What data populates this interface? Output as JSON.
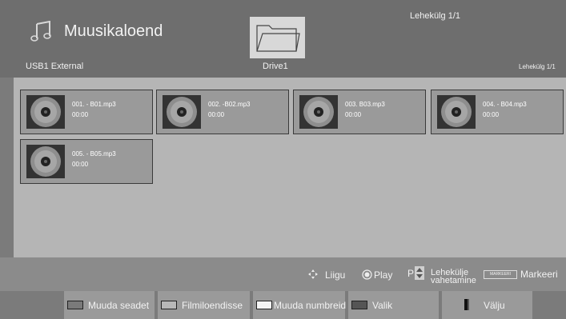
{
  "header": {
    "title": "Muusikaloend",
    "page_indicator_top": "Lehekülg 1/1",
    "device": "USB1 External",
    "folder_label": "Drive1",
    "page_indicator_right": "Lehekülg 1/1",
    "icons": {
      "app": "music-note-icon",
      "folder": "folder-icon"
    }
  },
  "files": [
    {
      "name": "001. - B01.mp3",
      "duration": "00:00"
    },
    {
      "name": "002. -B02.mp3",
      "duration": "00:00"
    },
    {
      "name": "003. B03.mp3",
      "duration": "00:00"
    },
    {
      "name": "004. - B04.mp3",
      "duration": "00:00"
    },
    {
      "name": "005. - B05.mp3",
      "duration": "00:00"
    }
  ],
  "help": {
    "move": "Liigu",
    "play": "Play",
    "page_key": "P",
    "page_change_line1": "Lehekülje",
    "page_change_line2": "vahetamine",
    "mark_badge": "MARKEERI",
    "mark": "Markeeri"
  },
  "buttons": [
    {
      "label": "Muuda seadet",
      "swatch": "#7a7a7a"
    },
    {
      "label": "Filmiloendisse",
      "swatch": "#b8b8b8"
    },
    {
      "label": "Muuda numbreid",
      "swatch": "#f4f4f4"
    },
    {
      "label": "Valik",
      "swatch": "#555555"
    },
    {
      "label": "Välju",
      "swatch": "#111111"
    }
  ],
  "colors": {
    "header_bg": "#6e6e6e",
    "content_bg": "#b5b5b5",
    "tile_bg": "#9a9a9a",
    "help_bg": "#8b8b8b",
    "bottom_bg": "#7b7b7b"
  }
}
